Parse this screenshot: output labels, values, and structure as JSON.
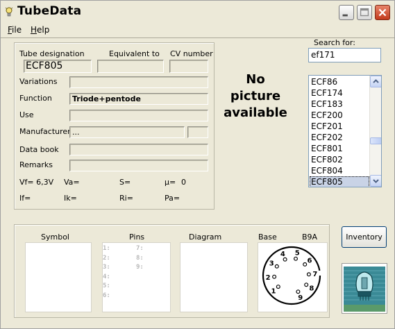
{
  "window": {
    "title": "TubeData"
  },
  "menu": {
    "file": "File",
    "help": "Help"
  },
  "details": {
    "tube_designation_label": "Tube designation",
    "tube_designation_value": "ECF805",
    "equivalent_to_label": "Equivalent to",
    "equivalent_to_value": "",
    "cv_number_label": "CV number",
    "cv_number_value": "",
    "variations_label": "Variations",
    "variations_value": "",
    "function_label": "Function",
    "function_value": "Triode+pentode",
    "use_label": "Use",
    "use_value": "",
    "manufacturer_label": "Manufacturer",
    "manufacturer_value": "...",
    "manufacturer_code_value": "",
    "data_book_label": "Data book",
    "data_book_value": "",
    "remarks_label": "Remarks",
    "remarks_value": ""
  },
  "params": {
    "vf": "Vf= 6,3V",
    "va": "Va=",
    "s": "S=",
    "mu_label": "µ=",
    "mu_value": "0",
    "if": "If=",
    "ik": "Ik=",
    "ri": "Ri=",
    "pa": "Pa="
  },
  "picture": {
    "line1": "No",
    "line2": "picture",
    "line3": "available"
  },
  "search": {
    "label": "Search for:",
    "value": "ef171"
  },
  "tube_list": {
    "items": [
      "ECF86",
      "ECF174",
      "ECF183",
      "ECF200",
      "ECF201",
      "ECF202",
      "ECF801",
      "ECF802",
      "ECF804",
      "ECF805"
    ],
    "selected_index": 9
  },
  "bottom": {
    "symbol_label": "Symbol",
    "pins_label": "Pins",
    "diagram_label": "Diagram",
    "base_label": "Base",
    "base_type": "B9A",
    "pins_left": [
      "1:",
      "2:",
      "3:",
      "4:",
      "5:",
      "6:"
    ],
    "pins_right": [
      "7:",
      "8:",
      "9:"
    ],
    "socket_pins": [
      "1",
      "2",
      "3",
      "4",
      "5",
      "6",
      "7",
      "8",
      "9"
    ]
  },
  "inventory": {
    "label": "Inventory"
  },
  "colors": {
    "window_bg": "#ECE9D8",
    "selected_bg": "#c9d3e6",
    "close_red": "#c23a1c"
  }
}
